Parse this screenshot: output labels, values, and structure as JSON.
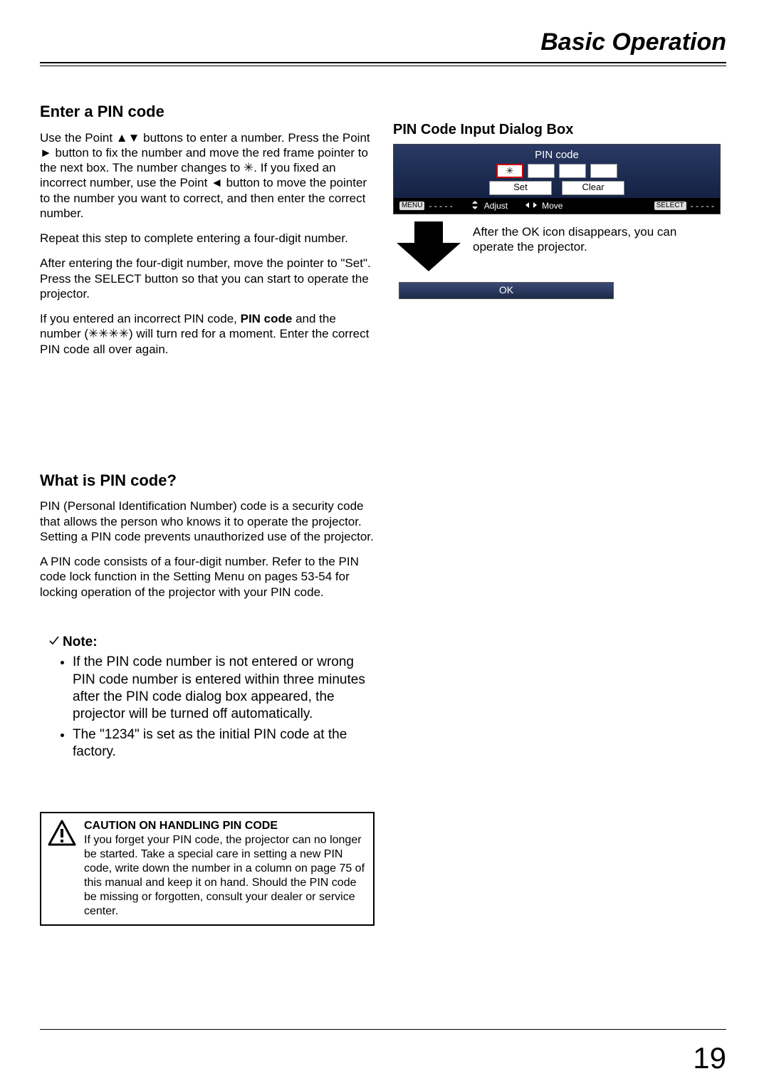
{
  "header": {
    "title": "Basic Operation"
  },
  "left": {
    "h1": "Enter a PIN code",
    "p1": "Use the Point ▲▼ buttons to enter a number. Press the Point ► button to fix the number and move the red frame pointer to the next box. The number changes to ✳. If you fixed an incorrect number, use the Point ◄ button to move the pointer to the number you want to correct, and then enter the correct number.",
    "p2": "Repeat this step to complete entering a four-digit number.",
    "p3": "After entering the four-digit number, move the pointer to \"Set\". Press the SELECT button so that you can start to operate the projector.",
    "p4_pre": "If you entered an incorrect PIN code, ",
    "p4_bold": "PIN code",
    "p4_post": " and the number (✳✳✳✳) will turn red for a moment. Enter the correct PIN code all over again.",
    "h2": "What is PIN code?",
    "p5": "PIN (Personal Identification Number) code is a security code that allows the person who knows it to operate the projector. Setting a PIN code prevents unauthorized use of the projector.",
    "p6": "A PIN code consists of a four-digit number. Refer to the PIN code lock function in the Setting Menu on pages 53-54 for locking operation of the projector with your PIN code.",
    "note_label": "Note:",
    "note1": "If the PIN code number is not entered or wrong PIN code number is entered within three minutes after the PIN code dialog box appeared, the projector will be turned off automatically.",
    "note2": "The \"1234\" is set as the initial PIN code at the factory.",
    "caution_title": "CAUTION ON HANDLING PIN CODE",
    "caution_body": "If you forget your PIN code, the projector can no longer be started. Take a special care in setting a new PIN code, write down the number in a column on page 75 of this manual and keep it on hand. Should the PIN code be missing or forgotten, consult your dealer or service center."
  },
  "right": {
    "heading": "PIN Code Input Dialog Box",
    "dialog": {
      "title": "PIN code",
      "field1": "✳",
      "field2": "",
      "field3": "",
      "field4": "",
      "set": "Set",
      "clear": "Clear",
      "menu_chip": "MENU",
      "menu_dashes": "- - - - -",
      "adjust": "Adjust",
      "move": "Move",
      "select_chip": "SELECT",
      "select_dashes": "- - - - -"
    },
    "arrow_text": "After the OK icon disappears, you can operate the projector.",
    "ok": "OK"
  },
  "page_number": "19"
}
